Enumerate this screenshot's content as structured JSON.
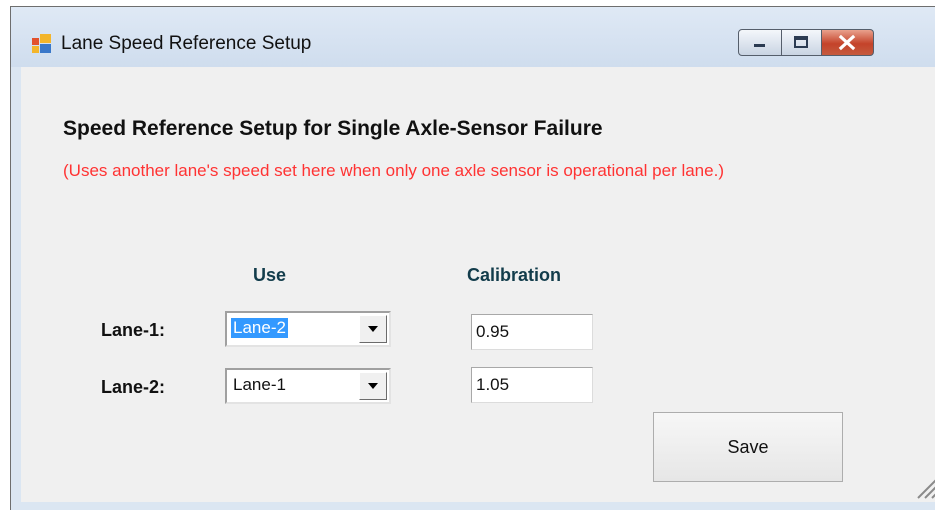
{
  "window": {
    "title": "Lane Speed Reference Setup",
    "icon": "app-window-icon",
    "controls": [
      "minimize-icon",
      "maximize-icon",
      "close-icon"
    ]
  },
  "form": {
    "header": "Speed Reference Setup for Single Axle-Sensor Failure",
    "note": "(Uses another lane's speed set here when only one axle sensor is operational per lane.)",
    "columns": {
      "use": "Use",
      "calibration": "Calibration"
    },
    "lanes": [
      {
        "label": "Lane-1:",
        "use": "Lane-2",
        "calibration": "0.95"
      },
      {
        "label": "Lane-2:",
        "use": "Lane-1",
        "calibration": "1.05"
      }
    ],
    "save_label": "Save"
  },
  "colors": {
    "note": "#ff3333",
    "column_header": "#123c4b",
    "selection": "#3399ff",
    "close_button": "#c4432a"
  }
}
